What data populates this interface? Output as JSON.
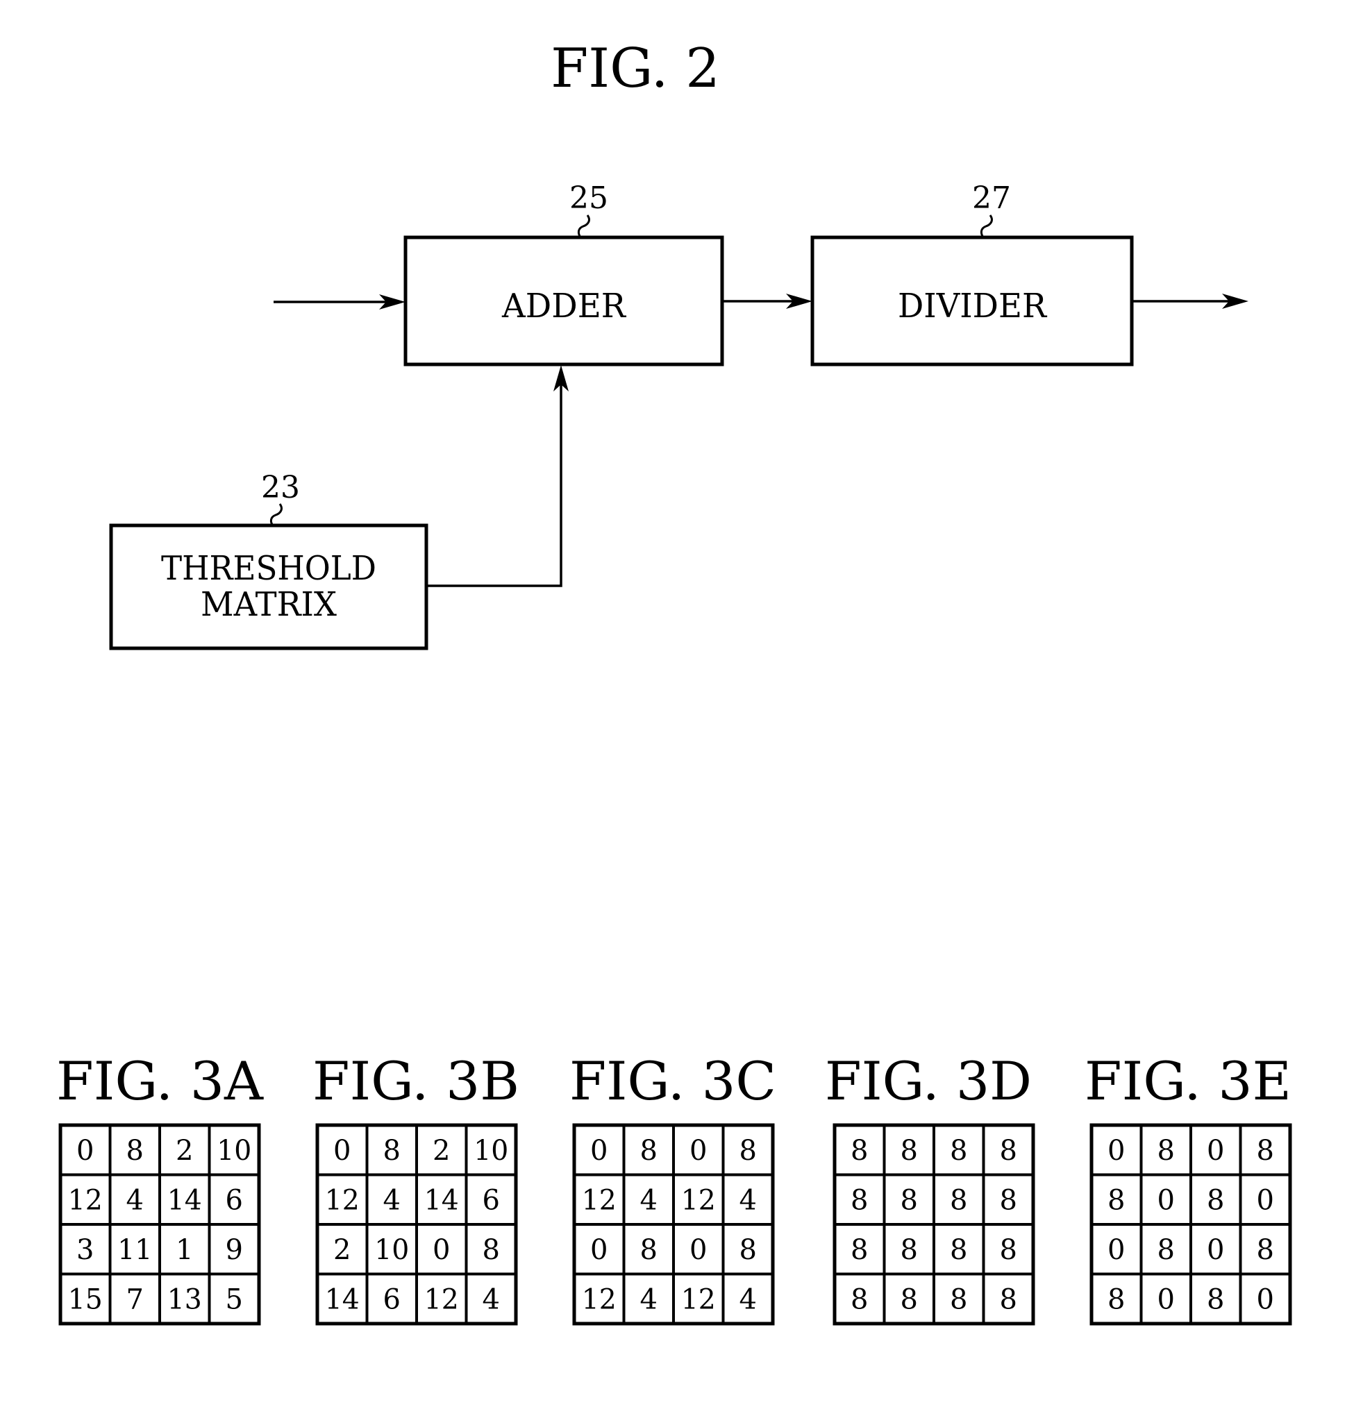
{
  "figure2": {
    "title": "FIG. 2",
    "blocks": {
      "adder": {
        "label": "ADDER",
        "ref": "25"
      },
      "divider": {
        "label": "DIVIDER",
        "ref": "27"
      },
      "threshold_matrix": {
        "label_line1": "THRESHOLD",
        "label_line2": "MATRIX",
        "ref": "23"
      }
    },
    "connections": [
      {
        "from": "input",
        "to": "adder"
      },
      {
        "from": "adder",
        "to": "divider"
      },
      {
        "from": "divider",
        "to": "output"
      },
      {
        "from": "threshold_matrix",
        "to": "adder"
      }
    ]
  },
  "figure3": {
    "matrices": [
      {
        "label": "FIG. 3A",
        "rows": [
          [
            "0",
            "8",
            "2",
            "10"
          ],
          [
            "12",
            "4",
            "14",
            "6"
          ],
          [
            "3",
            "11",
            "1",
            "9"
          ],
          [
            "15",
            "7",
            "13",
            "5"
          ]
        ]
      },
      {
        "label": "FIG. 3B",
        "rows": [
          [
            "0",
            "8",
            "2",
            "10"
          ],
          [
            "12",
            "4",
            "14",
            "6"
          ],
          [
            "2",
            "10",
            "0",
            "8"
          ],
          [
            "14",
            "6",
            "12",
            "4"
          ]
        ]
      },
      {
        "label": "FIG. 3C",
        "rows": [
          [
            "0",
            "8",
            "0",
            "8"
          ],
          [
            "12",
            "4",
            "12",
            "4"
          ],
          [
            "0",
            "8",
            "0",
            "8"
          ],
          [
            "12",
            "4",
            "12",
            "4"
          ]
        ]
      },
      {
        "label": "FIG. 3D",
        "rows": [
          [
            "8",
            "8",
            "8",
            "8"
          ],
          [
            "8",
            "8",
            "8",
            "8"
          ],
          [
            "8",
            "8",
            "8",
            "8"
          ],
          [
            "8",
            "8",
            "8",
            "8"
          ]
        ]
      },
      {
        "label": "FIG. 3E",
        "rows": [
          [
            "0",
            "8",
            "0",
            "8"
          ],
          [
            "8",
            "0",
            "8",
            "0"
          ],
          [
            "0",
            "8",
            "0",
            "8"
          ],
          [
            "8",
            "0",
            "8",
            "0"
          ]
        ]
      }
    ]
  }
}
